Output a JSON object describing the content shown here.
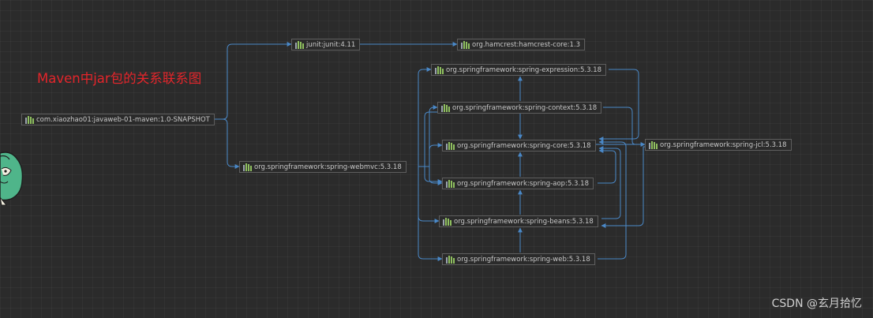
{
  "annotation": {
    "title": "Maven中jar包的关系联系图"
  },
  "watermark": "CSDN @玄月拾忆",
  "nodes": {
    "root": "com.xiaozhao01:javaweb-01-maven:1.0-SNAPSHOT",
    "junit": "junit:junit:4.11",
    "hamcrest": "org.hamcrest:hamcrest-core:1.3",
    "expression": "org.springframework:spring-expression:5.3.18",
    "context": "org.springframework:spring-context:5.3.18",
    "jcl": "org.springframework:spring-jcl:5.3.18",
    "core": "org.springframework:spring-core:5.3.18",
    "webmvc": "org.springframework:spring-webmvc:5.3.18",
    "aop": "org.springframework:spring-aop:5.3.18",
    "beans": "org.springframework:spring-beans:5.3.18",
    "web": "org.springframework:spring-web:5.3.18"
  },
  "icon": "library-icon",
  "colors": {
    "edge": "#4a88c7",
    "title": "#e5252b",
    "icon_green": "#8fbf5f",
    "icon_gray": "#9aa3ad"
  }
}
